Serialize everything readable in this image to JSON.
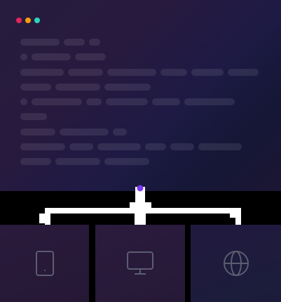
{
  "window": {
    "dot_colors": [
      "#e0245e",
      "#f59e0b",
      "#2dd4bf"
    ]
  },
  "code_lines": [
    [
      56,
      30,
      16
    ],
    [
      10,
      56,
      44
    ],
    [
      62,
      50,
      70,
      38,
      46,
      44
    ],
    [
      44,
      64,
      66
    ],
    [
      10,
      72,
      22,
      60,
      40,
      72
    ],
    [
      38
    ],
    [
      50,
      70,
      20
    ],
    [
      64,
      34,
      62,
      30,
      34,
      62
    ],
    [
      44,
      64,
      64
    ]
  ],
  "colors": {
    "connector": "#ffffff",
    "active_node": "#7c3aed",
    "icon_stroke": "#5b5d70"
  },
  "devices": [
    {
      "icon": "tablet-icon"
    },
    {
      "icon": "monitor-icon"
    },
    {
      "icon": "globe-icon"
    }
  ]
}
